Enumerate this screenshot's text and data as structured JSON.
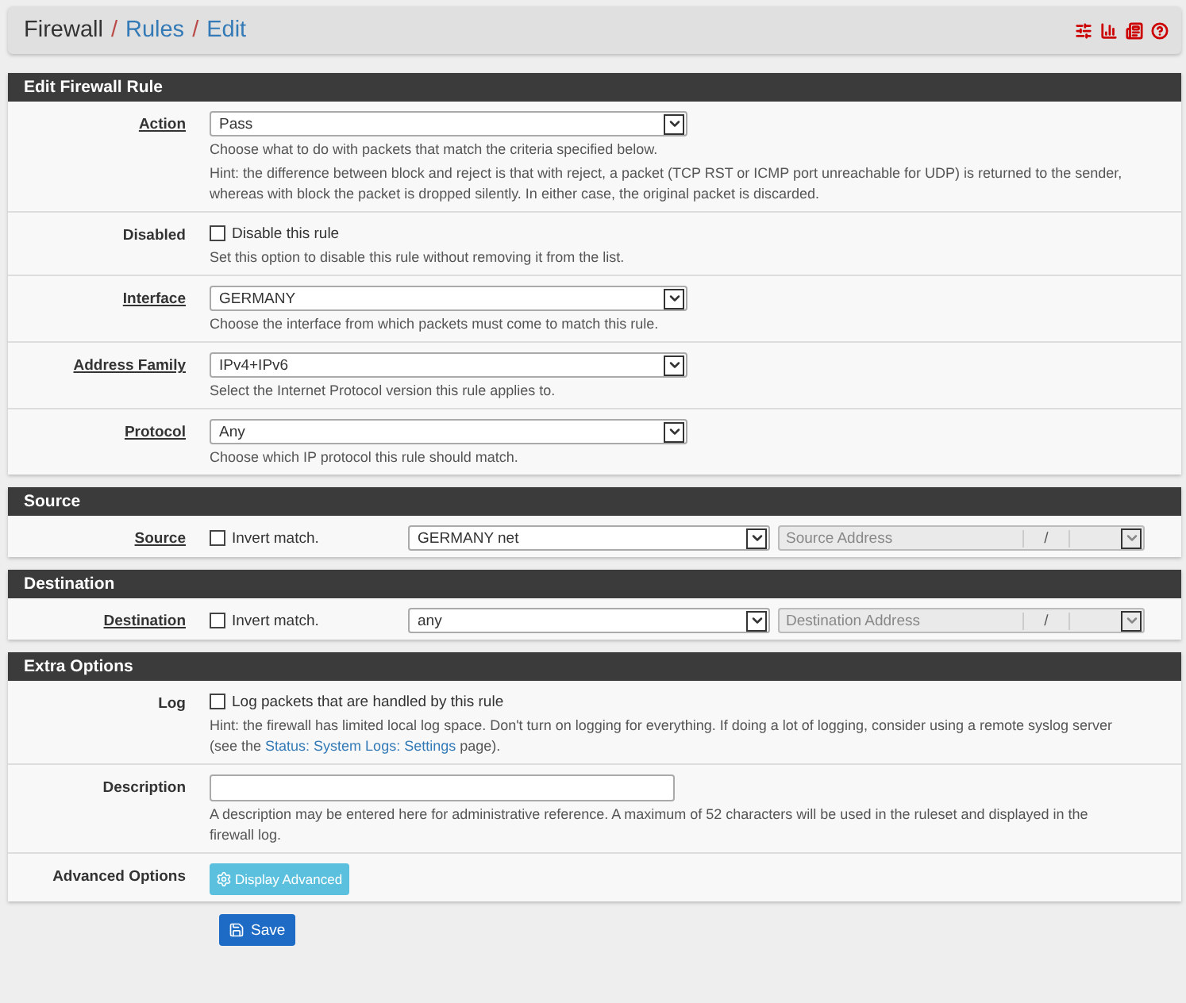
{
  "breadcrumb": [
    {
      "text": "Firewall",
      "link": false,
      "separator": "/"
    },
    {
      "text": "Rules",
      "link": true,
      "separator": "/"
    },
    {
      "text": "Edit",
      "link": true
    }
  ],
  "sections": [
    {
      "title": "Edit Firewall Rule",
      "rows": [
        {
          "kind": "select",
          "label": "Action",
          "required": true,
          "value": "Pass",
          "help": [
            [
              {
                "kind": "text",
                "text": "Choose what to do with packets that match the criteria specified below."
              }
            ],
            [
              {
                "kind": "text",
                "text": "Hint: the difference between block and reject is that with reject, a packet (TCP RST or ICMP port unreachable for UDP) is returned to the sender, whereas with block the packet is dropped silently. In either case, the original packet is discarded."
              }
            ]
          ]
        },
        {
          "kind": "checkbox",
          "label": "Disabled",
          "required": false,
          "option": "Disable this rule",
          "checked": false,
          "help": [
            [
              {
                "kind": "text",
                "text": "Set this option to disable this rule without removing it from the list."
              }
            ]
          ]
        },
        {
          "kind": "select",
          "label": "Interface",
          "required": true,
          "value": "GERMANY",
          "help": [
            [
              {
                "kind": "text",
                "text": "Choose the interface from which packets must come to match this rule."
              }
            ]
          ]
        },
        {
          "kind": "select",
          "label": "Address Family",
          "required": true,
          "value": "IPv4+IPv6",
          "help": [
            [
              {
                "kind": "text",
                "text": "Select the Internet Protocol version this rule applies to."
              }
            ]
          ]
        },
        {
          "kind": "select",
          "label": "Protocol",
          "required": true,
          "value": "Any",
          "help": [
            [
              {
                "kind": "text",
                "text": "Choose which IP protocol this rule should match."
              }
            ]
          ]
        }
      ]
    },
    {
      "title": "Source",
      "rows": [
        {
          "kind": "address",
          "label": "Source",
          "required": true,
          "option": "Invert match.",
          "checked": false,
          "value": "GERMANY net",
          "placeholder": "Source Address",
          "slash": "/"
        }
      ]
    },
    {
      "title": "Destination",
      "rows": [
        {
          "kind": "address",
          "label": "Destination",
          "required": true,
          "option": "Invert match.",
          "checked": false,
          "value": "any",
          "placeholder": "Destination Address",
          "slash": "/"
        }
      ]
    },
    {
      "title": "Extra Options",
      "rows": [
        {
          "kind": "checkbox",
          "label": "Log",
          "required": false,
          "option": "Log packets that are handled by this rule",
          "checked": false,
          "help": [
            [
              {
                "kind": "text",
                "text": "Hint: the firewall has limited local log space. Don't turn on logging for everything. If doing a lot of logging, consider using a remote syslog server (see the "
              },
              {
                "kind": "link",
                "text": "Status: System Logs: Settings"
              },
              {
                "kind": "text",
                "text": " page)."
              }
            ]
          ]
        },
        {
          "kind": "text",
          "label": "Description",
          "required": false,
          "help": [
            [
              {
                "kind": "text",
                "text": "A description may be entered here for administrative reference. A maximum of 52 characters will be used in the ruleset and displayed in the firewall log."
              }
            ]
          ]
        },
        {
          "kind": "button",
          "label": "Advanced Options",
          "required": false,
          "button": "Display Advanced"
        }
      ]
    }
  ],
  "save": "Save"
}
